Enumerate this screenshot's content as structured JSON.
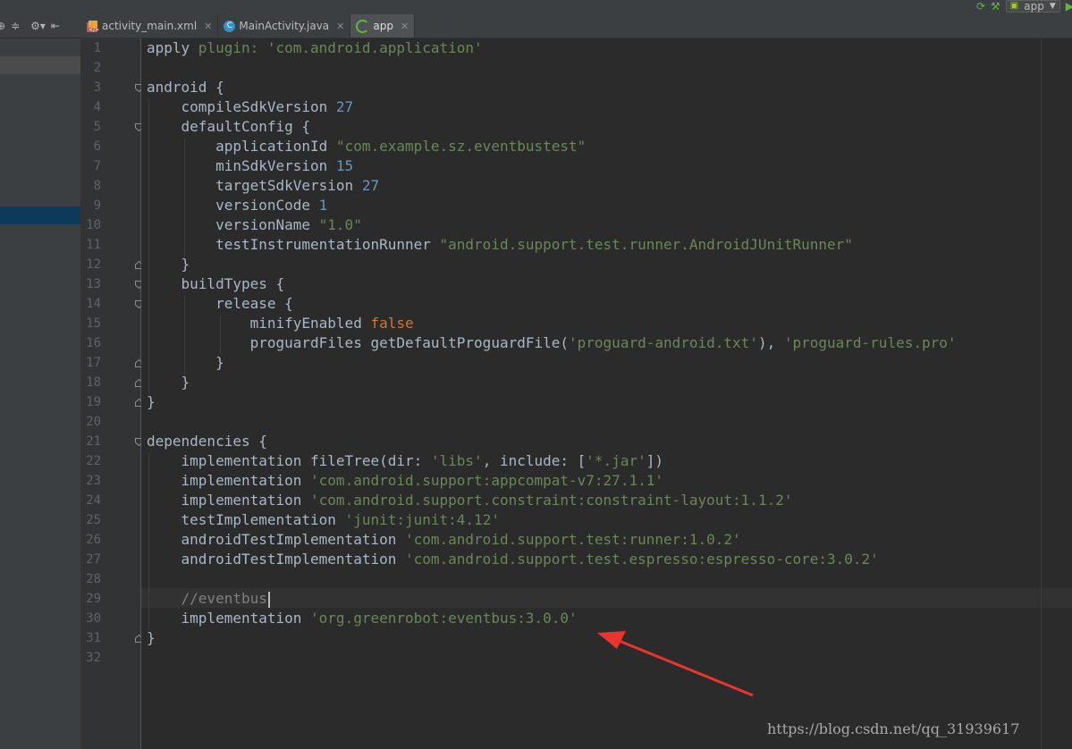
{
  "tabs": [
    {
      "label": "activity_main.xml",
      "icon": "xml-file-icon"
    },
    {
      "label": "MainActivity.java",
      "icon": "java-class-icon",
      "badge": "C"
    },
    {
      "label": "app",
      "icon": "gradle-icon",
      "active": true
    }
  ],
  "run_config": {
    "label": "app"
  },
  "line_numbers": [
    "1",
    "2",
    "3",
    "4",
    "5",
    "6",
    "7",
    "8",
    "9",
    "10",
    "11",
    "12",
    "13",
    "14",
    "15",
    "16",
    "17",
    "18",
    "19",
    "20",
    "21",
    "22",
    "23",
    "24",
    "25",
    "26",
    "27",
    "28",
    "29",
    "30",
    "31",
    "32"
  ],
  "code": {
    "l1": {
      "a": "apply ",
      "b": "plugin: ",
      "c": "'com.android.application'"
    },
    "l3": {
      "a": "android {"
    },
    "l4": {
      "a": "    compileSdkVersion ",
      "b": "27"
    },
    "l5": {
      "a": "    defaultConfig {"
    },
    "l6": {
      "a": "        applicationId ",
      "b": "\"com.example.sz.eventbustest\""
    },
    "l7": {
      "a": "        minSdkVersion ",
      "b": "15"
    },
    "l8": {
      "a": "        targetSdkVersion ",
      "b": "27"
    },
    "l9": {
      "a": "        versionCode ",
      "b": "1"
    },
    "l10": {
      "a": "        versionName ",
      "b": "\"1.0\""
    },
    "l11": {
      "a": "        testInstrumentationRunner ",
      "b": "\"android.support.test.runner.AndroidJUnitRunner\""
    },
    "l12": {
      "a": "    }"
    },
    "l13": {
      "a": "    buildTypes {"
    },
    "l14": {
      "a": "        release {"
    },
    "l15": {
      "a": "            minifyEnabled ",
      "b": "false"
    },
    "l16": {
      "a": "            proguardFiles getDefaultProguardFile(",
      "b": "'proguard-android.txt'",
      "c": "), ",
      "d": "'proguard-rules.pro'"
    },
    "l17": {
      "a": "        }"
    },
    "l18": {
      "a": "    }"
    },
    "l19": {
      "a": "}"
    },
    "l21": {
      "a": "dependencies {"
    },
    "l22": {
      "a": "    implementation fileTree(dir: ",
      "b": "'libs'",
      "c": ", include: [",
      "d": "'*.jar'",
      "e": "])"
    },
    "l23": {
      "a": "    implementation ",
      "b": "'com.android.support:appcompat-v7:27.1.1'"
    },
    "l24": {
      "a": "    implementation ",
      "b": "'com.android.support.constraint:constraint-layout:1.1.2'"
    },
    "l25": {
      "a": "    testImplementation ",
      "b": "'junit:junit:4.12'"
    },
    "l26": {
      "a": "    androidTestImplementation ",
      "b": "'com.android.support.test:runner:1.0.2'"
    },
    "l27": {
      "a": "    androidTestImplementation ",
      "b": "'com.android.support.test.espresso:espresso-core:3.0.2'"
    },
    "l29": {
      "a": "    ",
      "b": "//eventbus"
    },
    "l30": {
      "a": "    implementation ",
      "b": "'org.greenrobot:eventbus:3.0.0'"
    },
    "l31": {
      "a": "}"
    }
  },
  "watermark": "https://blog.csdn.net/qq_31939617",
  "colors": {
    "background": "#2b2b2b",
    "string": "#6a8759",
    "number": "#6897bb",
    "keyword": "#cc7832",
    "comment": "#808080",
    "annotation_arrow": "#e8352f"
  }
}
